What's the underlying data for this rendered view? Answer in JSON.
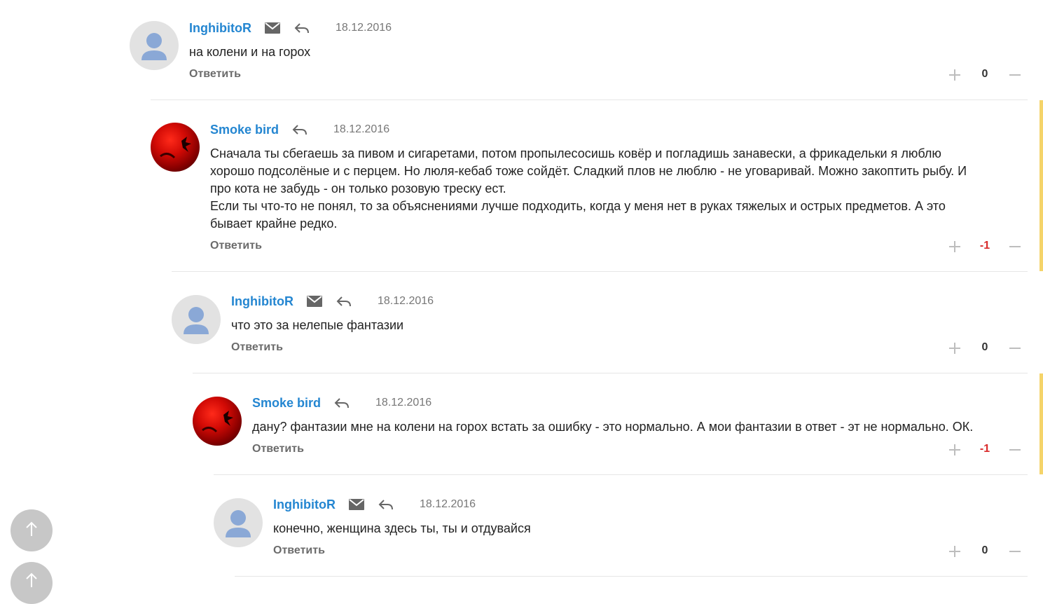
{
  "comments": [
    {
      "author": "InghibitoR",
      "date": "18.12.2016",
      "text": "на колени и на горох",
      "reply_label": "Ответить",
      "score": "0",
      "avatar": "default-user-avatar",
      "has_mail": true
    },
    {
      "author": "Smoke bird",
      "date": "18.12.2016",
      "text": "Сначала ты сбегаешь за пивом и сигаретами, потом пропылесосишь ковёр и погладишь занавески, а фрикадельки я люблю\nхорошо подсолёные и с перцем. Но люля-кебаб тоже сойдёт. Сладкий плов не люблю - не уговаривай. Можно закоптить рыбу. И\nпро кота не забудь - он только розовую треску ест.\nЕсли ты что-то не понял, то за объяснениями лучше подходить, когда у меня нет в руках тяжелых и острых предметов. А это\nбывает крайне редко.",
      "reply_label": "Ответить",
      "score": "-1",
      "avatar": "red-photo-avatar",
      "has_mail": false
    },
    {
      "author": "InghibitoR",
      "date": "18.12.2016",
      "text": "что это за нелепые фантазии",
      "reply_label": "Ответить",
      "score": "0",
      "avatar": "default-user-avatar",
      "has_mail": true
    },
    {
      "author": "Smoke bird",
      "date": "18.12.2016",
      "text": "дану? фантазии мне на колени на горох встать за ошибку - это нормально. А мои фантазии в ответ - эт не нормально. ОК.",
      "reply_label": "Ответить",
      "score": "-1",
      "avatar": "red-photo-avatar",
      "has_mail": false
    },
    {
      "author": "InghibitoR",
      "date": "18.12.2016",
      "text": "конечно, женщина здесь ты, ты и отдувайся",
      "reply_label": "Ответить",
      "score": "0",
      "avatar": "default-user-avatar",
      "has_mail": true
    }
  ],
  "icons": {
    "mail": "mail-icon",
    "reply": "reply-arrow-icon",
    "plus": "plus-icon",
    "minus": "minus-icon",
    "scroll_up": "arrow-up-icon"
  },
  "colors": {
    "author": "#2486d1",
    "negative_score": "#d92b2b",
    "accent_bar": "#f5d46a",
    "fab": "#c7c7c7"
  }
}
